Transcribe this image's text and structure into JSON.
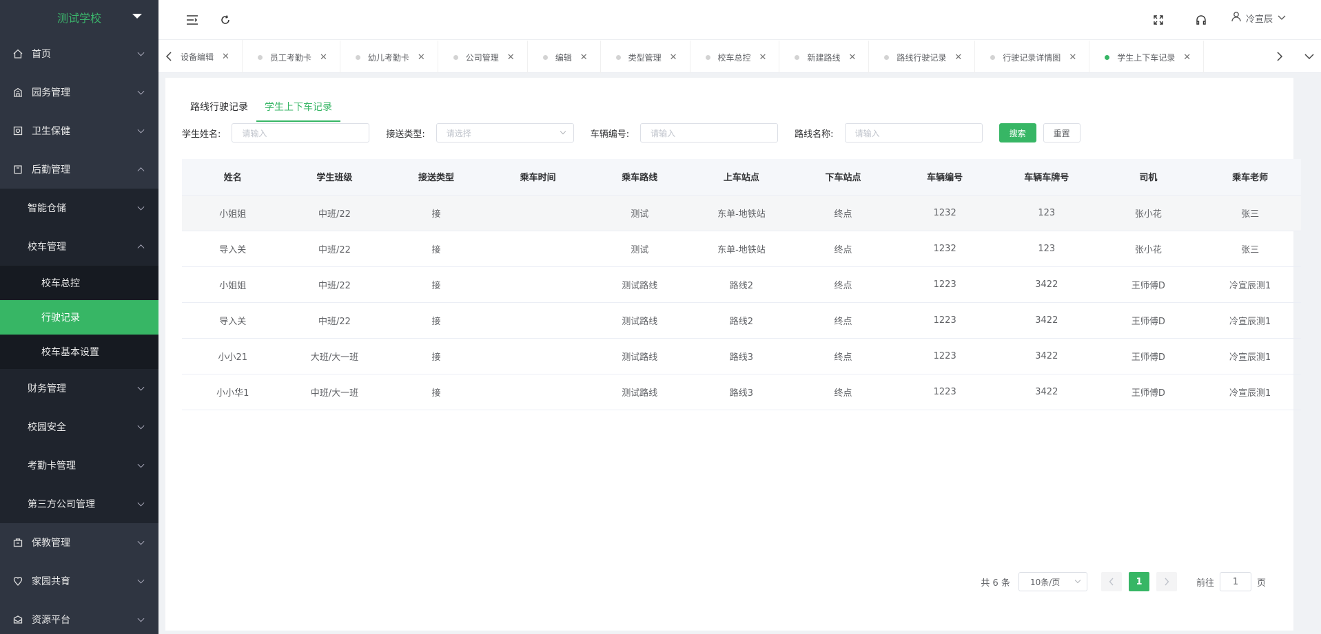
{
  "sidebar": {
    "school_name": "测试学校",
    "menu": [
      {
        "label": "首页",
        "icon": "home-icon"
      },
      {
        "label": "园务管理",
        "icon": "building-icon"
      },
      {
        "label": "卫生保健",
        "icon": "health-icon"
      },
      {
        "label": "后勤管理",
        "icon": "logistics-icon",
        "expanded": true
      }
    ],
    "logistics_sub": [
      {
        "label": "智能仓储"
      },
      {
        "label": "校车管理",
        "expanded": true
      }
    ],
    "bus_sub": [
      {
        "label": "校车总控"
      },
      {
        "label": "行驶记录",
        "active": true
      },
      {
        "label": "校车基本设置"
      }
    ],
    "logistics_sub2": [
      {
        "label": "财务管理"
      },
      {
        "label": "校园安全"
      },
      {
        "label": "考勤卡管理"
      },
      {
        "label": "第三方公司管理"
      }
    ],
    "menu_bottom": [
      {
        "label": "保教管理",
        "icon": "teaching-icon"
      },
      {
        "label": "家园共育",
        "icon": "heart-location-icon"
      },
      {
        "label": "资源平台",
        "icon": "resource-icon"
      }
    ]
  },
  "header": {
    "user_name": "冷宣辰"
  },
  "tabs": [
    {
      "label": "设备编辑"
    },
    {
      "label": "员工考勤卡"
    },
    {
      "label": "幼儿考勤卡"
    },
    {
      "label": "公司管理"
    },
    {
      "label": "编辑"
    },
    {
      "label": "类型管理"
    },
    {
      "label": "校车总控"
    },
    {
      "label": "新建路线"
    },
    {
      "label": "路线行驶记录"
    },
    {
      "label": "行驶记录详情图"
    },
    {
      "label": "学生上下车记录",
      "active": true
    }
  ],
  "subtabs": [
    {
      "label": "路线行驶记录"
    },
    {
      "label": "学生上下车记录",
      "active": true
    }
  ],
  "filters": {
    "student_name_label": "学生姓名:",
    "student_name_placeholder": "请输入",
    "pickup_type_label": "接送类型:",
    "pickup_type_placeholder": "请选择",
    "vehicle_no_label": "车辆编号:",
    "vehicle_no_placeholder": "请输入",
    "route_name_label": "路线名称:",
    "route_name_placeholder": "请输入",
    "search_label": "搜索",
    "reset_label": "重置"
  },
  "table": {
    "columns": [
      "姓名",
      "学生班级",
      "接送类型",
      "乘车时间",
      "乘车路线",
      "上车站点",
      "下车站点",
      "车辆编号",
      "车辆车牌号",
      "司机",
      "乘车老师"
    ],
    "rows": [
      [
        "小姐姐",
        "中班/22",
        "接",
        "",
        "测试",
        "东单-地铁站",
        "终点",
        "1232",
        "123",
        "张小花",
        "张三"
      ],
      [
        "导入关",
        "中班/22",
        "接",
        "",
        "测试",
        "东单-地铁站",
        "终点",
        "1232",
        "123",
        "张小花",
        "张三"
      ],
      [
        "小姐姐",
        "中班/22",
        "接",
        "",
        "测试路线",
        "路线2",
        "终点",
        "1223",
        "3422",
        "王师傅D",
        "冷宣辰测1"
      ],
      [
        "导入关",
        "中班/22",
        "接",
        "",
        "测试路线",
        "路线2",
        "终点",
        "1223",
        "3422",
        "王师傅D",
        "冷宣辰测1"
      ],
      [
        "小小21",
        "大班/大一班",
        "接",
        "",
        "测试路线",
        "路线3",
        "终点",
        "1223",
        "3422",
        "王师傅D",
        "冷宣辰测1"
      ],
      [
        "小小华1",
        "中班/大一班",
        "接",
        "",
        "测试路线",
        "路线3",
        "终点",
        "1223",
        "3422",
        "王师傅D",
        "冷宣辰测1"
      ]
    ]
  },
  "pagination": {
    "total_text": "共 6 条",
    "page_size": "10条/页",
    "current_page": "1",
    "goto_prefix": "前往",
    "goto_value": "1",
    "goto_suffix": "页"
  },
  "colors": {
    "accent": "#37b665",
    "sidebar_bg": "#2f3541"
  }
}
